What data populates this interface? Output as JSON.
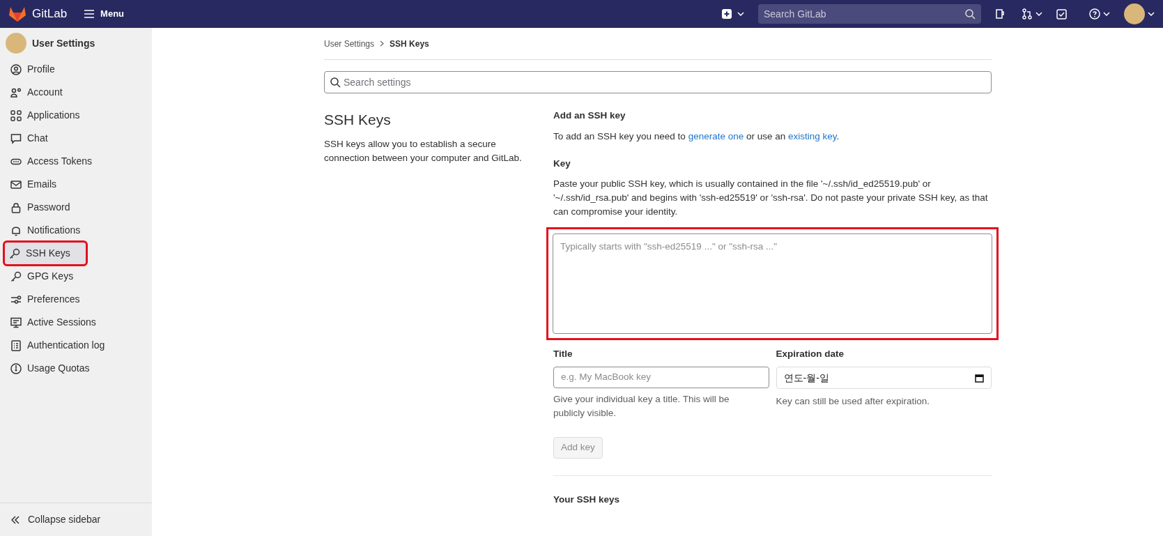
{
  "topbar": {
    "brand": "GitLab",
    "menu": "Menu",
    "search": {
      "placeholder": "Search GitLab"
    }
  },
  "sidebar": {
    "title": "User Settings",
    "items": [
      {
        "label": "Profile",
        "selected": false,
        "highlighted": false
      },
      {
        "label": "Account",
        "selected": false,
        "highlighted": false
      },
      {
        "label": "Applications",
        "selected": false,
        "highlighted": false
      },
      {
        "label": "Chat",
        "selected": false,
        "highlighted": false
      },
      {
        "label": "Access Tokens",
        "selected": false,
        "highlighted": false
      },
      {
        "label": "Emails",
        "selected": false,
        "highlighted": false
      },
      {
        "label": "Password",
        "selected": false,
        "highlighted": false
      },
      {
        "label": "Notifications",
        "selected": false,
        "highlighted": false
      },
      {
        "label": "SSH Keys",
        "selected": true,
        "highlighted": true
      },
      {
        "label": "GPG Keys",
        "selected": false,
        "highlighted": false
      },
      {
        "label": "Preferences",
        "selected": false,
        "highlighted": false
      },
      {
        "label": "Active Sessions",
        "selected": false,
        "highlighted": false
      },
      {
        "label": "Authentication log",
        "selected": false,
        "highlighted": false
      },
      {
        "label": "Usage Quotas",
        "selected": false,
        "highlighted": false
      }
    ],
    "collapse": "Collapse sidebar"
  },
  "breadcrumb": [
    "User Settings",
    "SSH Keys"
  ],
  "settings_search": {
    "placeholder": "Search settings"
  },
  "section": {
    "title": "SSH Keys",
    "description": "SSH keys allow you to establish a secure connection between your computer and GitLab."
  },
  "form": {
    "heading": "Add an SSH key",
    "intro": {
      "before": "To add an SSH key you need to ",
      "link1": "generate one",
      "middle": " or use an ",
      "link2": "existing key",
      "after": "."
    },
    "key_label": "Key",
    "key_help": "Paste your public SSH key, which is usually contained in the file '~/.ssh/id_ed25519.pub' or '~/.ssh/id_rsa.pub' and begins with 'ssh-ed25519' or 'ssh-rsa'. Do not paste your private SSH key, as that can compromise your identity.",
    "key_field": {
      "placeholder": "Typically starts with \"ssh-ed25519 ...\" or \"ssh-rsa ...\"",
      "highlighted": true
    },
    "title_label": "Title",
    "title_field": {
      "placeholder": "e.g. My MacBook key"
    },
    "title_help": "Give your individual key a title. This will be publicly visible.",
    "expiration_label": "Expiration date",
    "expiration_field": {
      "placeholder": "연도-월-일"
    },
    "expiration_help": "Key can still be used after expiration.",
    "submit": {
      "label": "Add key",
      "disabled": true
    }
  },
  "keys_heading": "Your SSH keys"
}
